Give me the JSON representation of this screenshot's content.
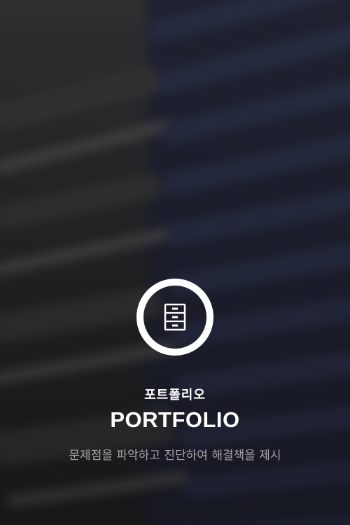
{
  "card": {
    "icon": "file-cabinet-icon",
    "title_ko": "포트폴리오",
    "title_en": "PORTFOLIO",
    "subtitle": "문제점을 파악하고 진단하여 해결책을 제시"
  },
  "colors": {
    "icon_ring": "#ffffff",
    "title": "#ffffff",
    "subtitle": "#a5a5a8"
  }
}
